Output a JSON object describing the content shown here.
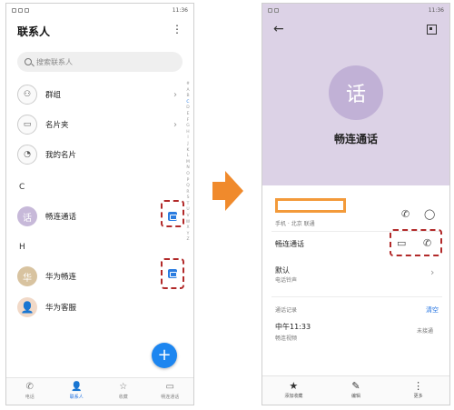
{
  "left": {
    "title": "联系人",
    "search_placeholder": "搜索联系人",
    "rows": [
      {
        "label": "群组"
      },
      {
        "label": "名片夹"
      },
      {
        "label": "我的名片"
      }
    ],
    "section_c": "C",
    "section_h": "H",
    "contacts": [
      {
        "name": "畅连通话",
        "avatar": "话"
      },
      {
        "name": "华为畅连",
        "avatar": "华"
      },
      {
        "name": "华为客服",
        "avatar": "👤"
      }
    ],
    "alpha_index": [
      "#",
      "A",
      "B",
      "C",
      "D",
      "E",
      "F",
      "G",
      "H",
      "I",
      "J",
      "K",
      "L",
      "M",
      "N",
      "O",
      "P",
      "Q",
      "R",
      "S",
      "T",
      "U",
      "V",
      "W",
      "X",
      "Y",
      "Z"
    ],
    "tabs": [
      {
        "label": "电话",
        "icon": "phone-icon"
      },
      {
        "label": "联系人",
        "icon": "person-icon"
      },
      {
        "label": "收藏",
        "icon": "star-icon"
      },
      {
        "label": "畅连通话",
        "icon": "chat-icon"
      }
    ],
    "fab": "+",
    "status_time": "11:36"
  },
  "right": {
    "avatar_char": "话",
    "name": "畅连通话",
    "phone_meta": "手机 · 北京 联通",
    "row_changlian": "畅连通话",
    "default_label": "默认",
    "ringtone_label": "电话铃声",
    "history_label": "通话记录",
    "clear_label": "清空",
    "call_time": "中午11:33",
    "call_type": "畅连视频",
    "call_status": "未接通",
    "toolbar": [
      {
        "label": "添加收藏",
        "icon": "star-icon"
      },
      {
        "label": "编辑",
        "icon": "pencil-icon"
      },
      {
        "label": "更多",
        "icon": "more-icon"
      }
    ],
    "status_time": "11:36"
  },
  "colors": {
    "accent": "#1d86f0",
    "highlight_dash": "#b22a2a",
    "highlight_orange": "#f39a3a",
    "header_lavender": "#dcd2e6"
  }
}
